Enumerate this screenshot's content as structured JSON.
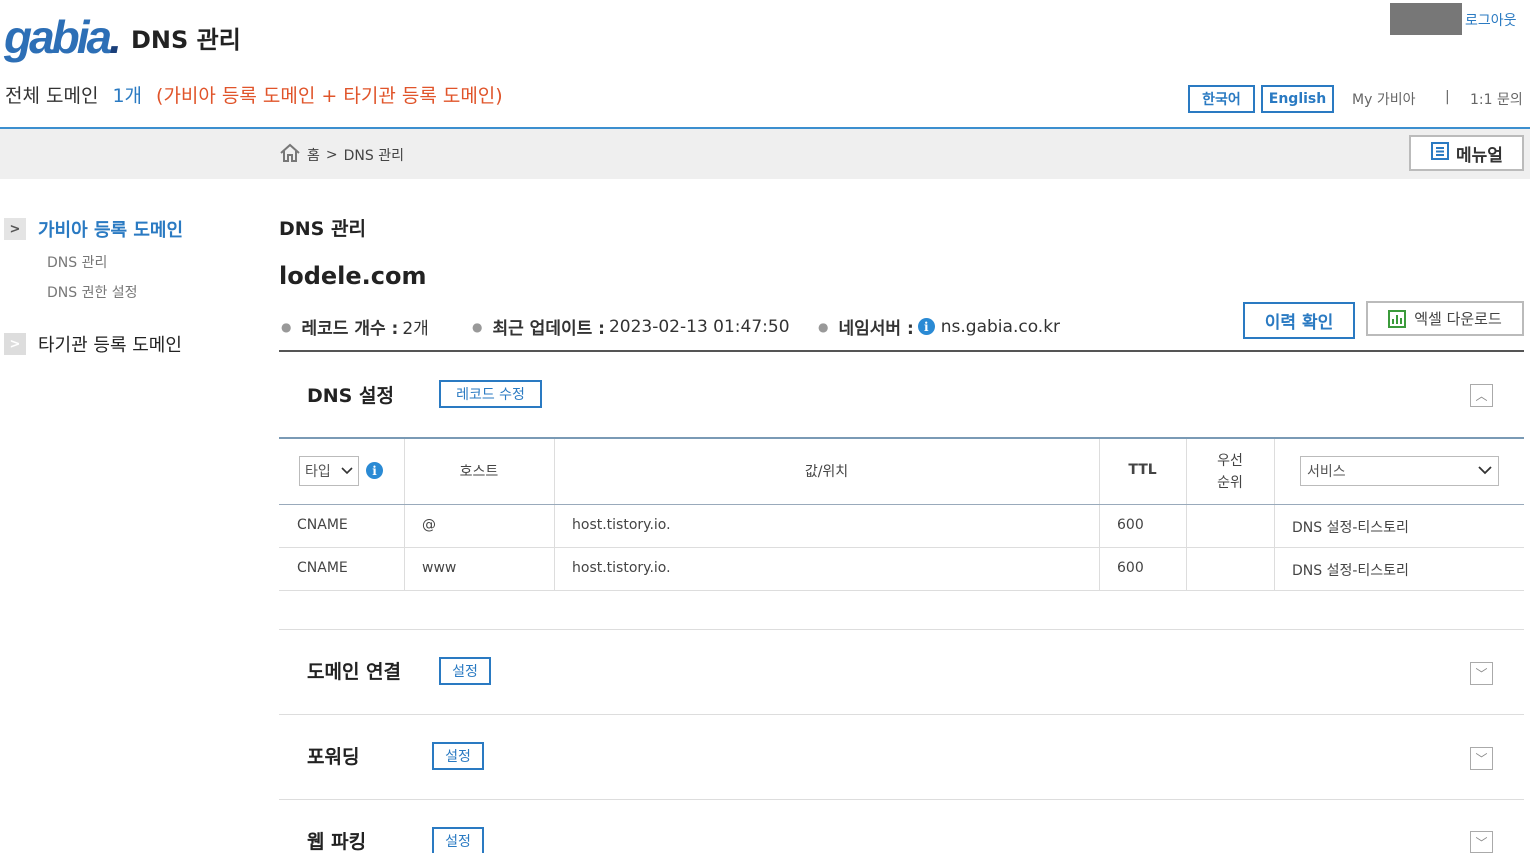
{
  "header": {
    "logo_text": "gabia",
    "logo_dot": ".",
    "app_title": "DNS 관리",
    "logout_label": "로그아웃",
    "domain_total_label": "전체 도메인",
    "domain_total_count": "1개",
    "domain_total_note": "(가비아 등록 도메인 + 타기관 등록 도메인)",
    "lang_ko": "한국어",
    "lang_en": "English",
    "my_gabia": "My 가비아",
    "separator": "|",
    "inquiry": "1:1 문의"
  },
  "breadcrumb": {
    "home": "홈",
    "arrow": ">",
    "current": "DNS 관리"
  },
  "manual_button": "메뉴얼",
  "sidebar": {
    "groups": [
      {
        "label": "가비아 등록 도메인",
        "subitems": [
          "DNS 관리",
          "DNS 권한 설정"
        ]
      },
      {
        "label": "타기관 등록 도메인"
      }
    ]
  },
  "main": {
    "title": "DNS 관리",
    "domain": "lodele.com",
    "meta": {
      "record_count_label": "레코드 개수 :",
      "record_count_value": "2개",
      "updated_label": "최근 업데이트 :",
      "updated_value": "2023-02-13 01:47:50",
      "nameserver_label": "네임서버 :",
      "nameserver_value": "ns.gabia.co.kr"
    },
    "history_button": "이력 확인",
    "excel_button": "엑셀 다운로드",
    "dns_panel": {
      "title": "DNS 설정",
      "edit_button": "레코드 수정",
      "columns": {
        "type": "타입",
        "host": "호스트",
        "value": "값/위치",
        "ttl": "TTL",
        "priority_line1": "우선",
        "priority_line2": "순위",
        "service": "서비스"
      },
      "rows": [
        {
          "type": "CNAME",
          "host": "@",
          "value": "host.tistory.io.",
          "ttl": "600",
          "priority": "",
          "service": "DNS 설정-티스토리"
        },
        {
          "type": "CNAME",
          "host": "www",
          "value": "host.tistory.io.",
          "ttl": "600",
          "priority": "",
          "service": "DNS 설정-티스토리"
        }
      ]
    },
    "panels": [
      {
        "title": "도메인 연결",
        "button": "설정"
      },
      {
        "title": "포워딩",
        "button": "설정"
      },
      {
        "title": "웹 파킹",
        "button": "설정"
      }
    ]
  },
  "colors": {
    "accent": "#2a7ac2",
    "note": "#e0542a",
    "info": "#2a8ad4",
    "excel": "#3b9b3b"
  }
}
